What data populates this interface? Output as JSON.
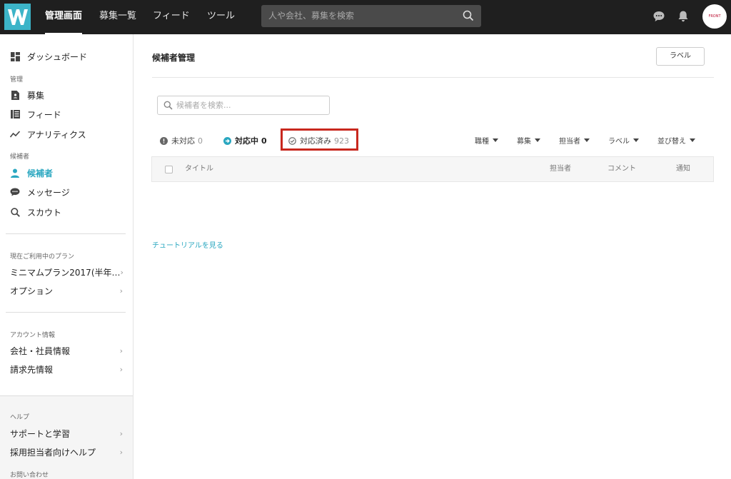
{
  "topbar": {
    "logo_letter": "W",
    "nav": [
      {
        "label": "管理画面",
        "active": true
      },
      {
        "label": "募集一覧",
        "active": false
      },
      {
        "label": "フィード",
        "active": false
      },
      {
        "label": "ツール",
        "active": false
      }
    ],
    "search_placeholder": "人や会社、募集を検索",
    "icons": [
      "chat-icon",
      "bell-icon"
    ],
    "avatar_text": "FRONT"
  },
  "sidebar": {
    "dashboard": "ダッシュボード",
    "section_manage": "管理",
    "manage_items": [
      "募集",
      "フィード",
      "アナリティクス"
    ],
    "section_candidates": "候補者",
    "candidate_items": [
      "候補者",
      "メッセージ",
      "スカウト"
    ],
    "section_plan": "現在ご利用中のプラン",
    "plan_items": [
      "ミニマムプラン2017(半年…",
      "オプション"
    ],
    "section_account": "アカウント情報",
    "account_items": [
      "会社・社員情報",
      "請求先情報"
    ],
    "section_help": "ヘルプ",
    "help_items": [
      "サポートと学習",
      "採用担当者向けヘルプ"
    ],
    "section_contact": "お問い合わせ"
  },
  "main": {
    "title": "候補者管理",
    "label_button": "ラベル",
    "search_placeholder": "候補者を検索...",
    "status_tabs": [
      {
        "label": "未対応",
        "count": "0"
      },
      {
        "label": "対応中",
        "count": "0"
      },
      {
        "label": "対応済み",
        "count": "923"
      }
    ],
    "filters": [
      "職種",
      "募集",
      "担当者",
      "ラベル",
      "並び替え"
    ],
    "table_headers": {
      "title": "タイトル",
      "assignee": "担当者",
      "comment": "コメント",
      "notify": "通知"
    },
    "tutorial_link": "チュートリアルを見る"
  },
  "colors": {
    "accent": "#2aa7c0",
    "logo_bg": "#3cb4c8",
    "topbar_bg": "#1f1f1f",
    "highlight": "#c8281e"
  }
}
